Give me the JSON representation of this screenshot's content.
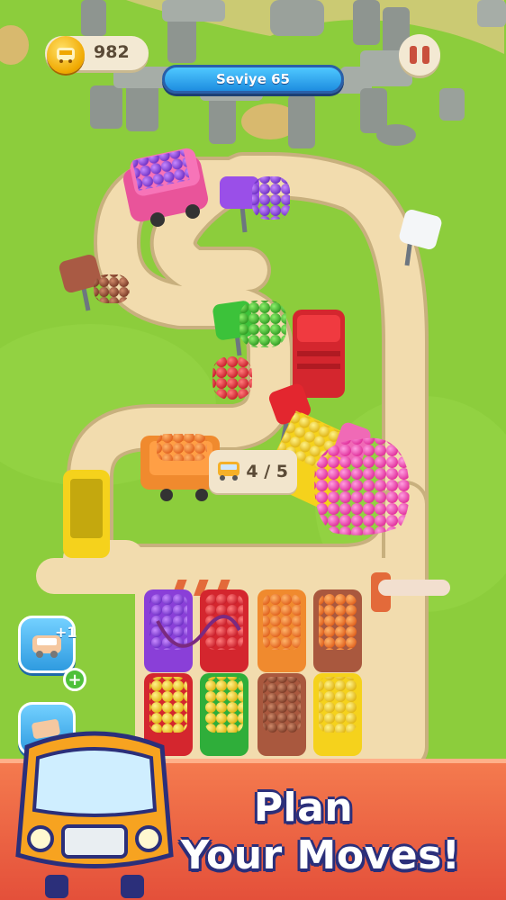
{
  "hud": {
    "coins": "982",
    "level_label": "Seviye 65",
    "coin_icon": "bus-coin-icon",
    "pause_icon": "pause-icon"
  },
  "side_buttons": {
    "add_vehicle_badge": "+1",
    "add_vehicle_plus": "+"
  },
  "capacity": {
    "text": "4 / 5"
  },
  "banner": {
    "line1": "Plan",
    "line2": "Your Moves!"
  },
  "colors": {
    "grass": "#8ccd3c",
    "road": "#f2dcae",
    "banner": "#e4503a",
    "level_bar": "#1e8de0",
    "text_outline": "#2b2f7a"
  }
}
